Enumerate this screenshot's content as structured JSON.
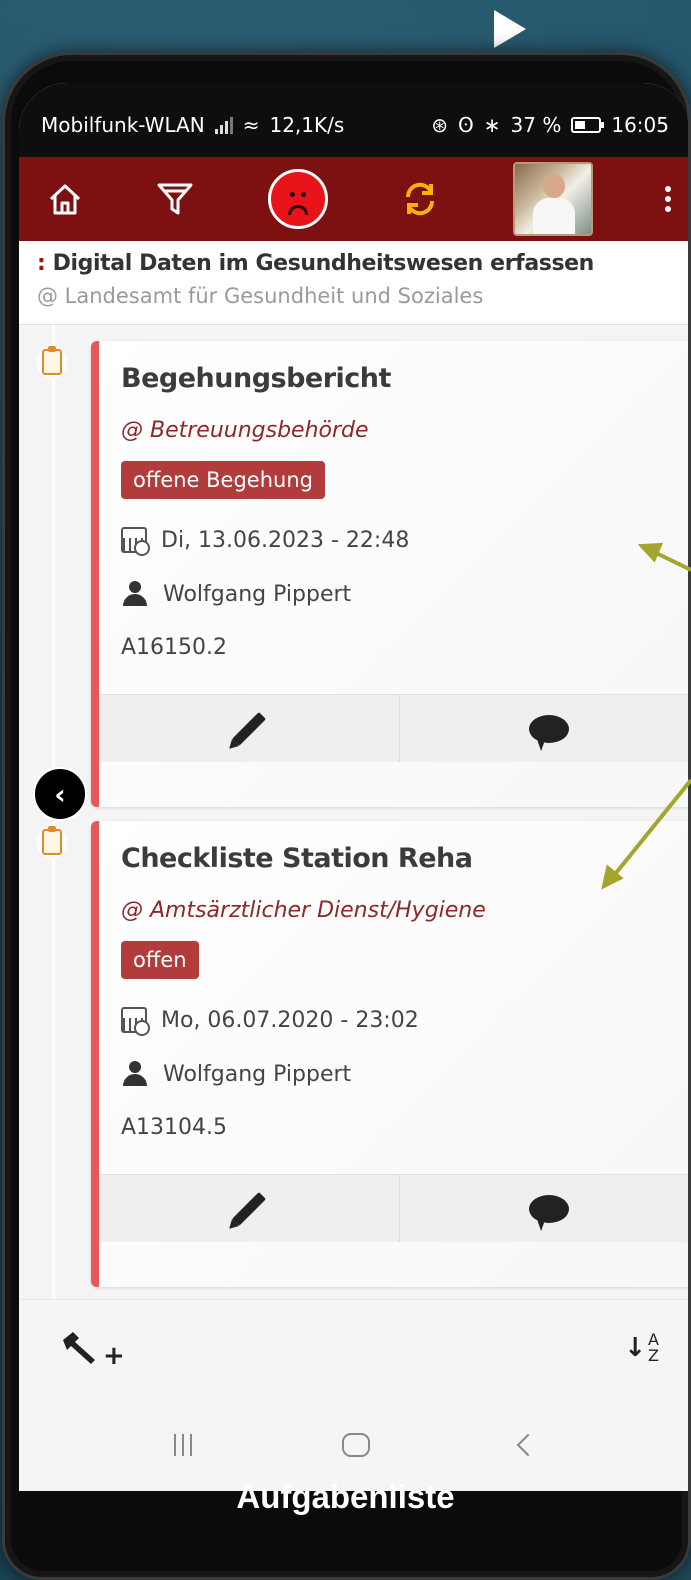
{
  "status_bar": {
    "network": "Mobilfunk-WLAN",
    "speed": "12,1K/s",
    "battery": "37 %",
    "time": "16:05"
  },
  "toolbar": {
    "home_icon": "home-icon",
    "filter_icon": "filter-icon",
    "mood_icon": "sad-face-icon",
    "sync_icon": "sync-icon",
    "menu_icon": "more-vert-icon"
  },
  "project": {
    "prefix": ":",
    "title": "Digital Daten im Gesundheitswesen erfassen",
    "organization": "@ Landesamt für Gesundheit und Soziales"
  },
  "tasks": [
    {
      "title": "Begehungsbericht",
      "org": "@ Betreuungsbehörde",
      "status": "offene Begehung",
      "date": "Di, 13.06.2023 - 22:48",
      "person": "Wolfgang Pippert",
      "id": "A16150.2"
    },
    {
      "title": "Checkliste Station Reha",
      "org": "@ Amtsärztlicher Dienst/Hygiene",
      "status": "offen",
      "date": "Mo, 06.07.2020 - 23:02",
      "person": "Wolfgang Pippert",
      "id": "A13104.5"
    }
  ],
  "colors": {
    "toolbar": "#7d1111",
    "accent_bar": "#e8575a",
    "badge": "#b23c3c",
    "org_text": "#8e2828",
    "annotation_arrow": "#a3a52c"
  },
  "caption": "Aufgabenliste"
}
